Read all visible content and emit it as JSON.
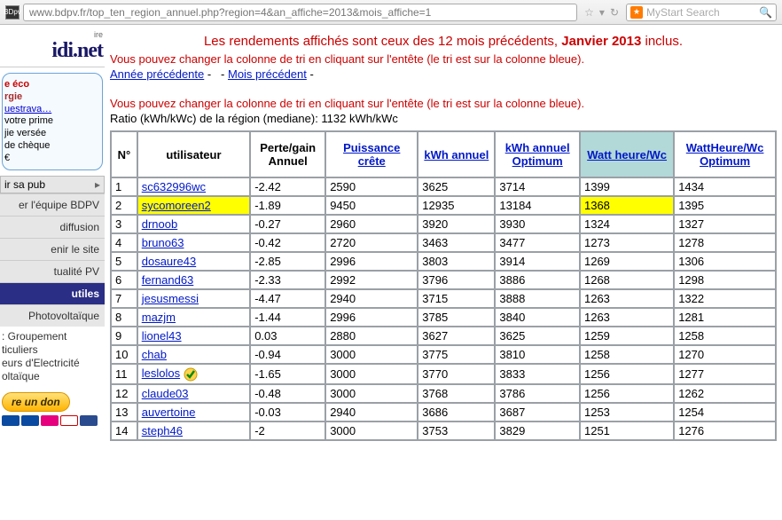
{
  "browser": {
    "url": "www.bdpv.fr/top_ten_region_annuel.php?region=4&an_affiche=2013&mois_affiche=1",
    "search_placeholder": "MyStart Search",
    "favicon_text": "BDpv"
  },
  "sidebar": {
    "logo": "idi.net",
    "panel_line1a": "e éco",
    "panel_line1b": "rgie",
    "panel_more": "uestrava…",
    "panel_line2": "votre prime",
    "panel_line3": "jie versée",
    "panel_line4": "de chèque",
    "panel_line5": "€",
    "pub": "ir sa pub",
    "items": [
      {
        "label": "er l'équipe BDPV"
      },
      {
        "label": "diffusion"
      },
      {
        "label": "enir le site"
      },
      {
        "label": "tualité PV"
      },
      {
        "label": "utiles"
      },
      {
        "label": "Photovoltaïque"
      }
    ],
    "sub": ": Groupement\nticuliers\neurs d'Electricité\noltaïque",
    "donate": "re un don"
  },
  "content": {
    "headline_pre": "Les rendements affichés sont ceux des 12 mois précédents, ",
    "headline_bold": "Janvier 2013",
    "headline_post": " inclus.",
    "info1": "Vous pouvez changer la colonne de tri en cliquant sur l'entête (le tri est sur la colonne bleue).",
    "link_prev_year": "Année précédente",
    "link_prev_month": "Mois précédent",
    "info2": "Vous pouvez changer la colonne de tri en cliquant sur l'entête (le tri est sur la colonne bleue).",
    "ratio": "Ratio (kWh/kWc) de la région (mediane): 1132 kWh/kWc",
    "headers": {
      "n": "N°",
      "user": "utilisateur",
      "perte": "Perte/gain Annuel",
      "pc": "Puissance crête",
      "kwh": "kWh annuel",
      "kwho": "kWh annuel Optimum",
      "wh": "Watt heure/Wc",
      "who": "WattHeure/Wc Optimum"
    },
    "rows": [
      {
        "n": "1",
        "user": "sc632996wc",
        "pg": "-2.42",
        "pc": "2590",
        "kwh": "3625",
        "kwho": "3714",
        "wh": "1399",
        "who": "1434"
      },
      {
        "n": "2",
        "user": "sycomoreen2",
        "pg": "-1.89",
        "pc": "9450",
        "kwh": "12935",
        "kwho": "13184",
        "wh": "1368",
        "who": "1395",
        "hl": true
      },
      {
        "n": "3",
        "user": "drnoob",
        "pg": "-0.27",
        "pc": "2960",
        "kwh": "3920",
        "kwho": "3930",
        "wh": "1324",
        "who": "1327"
      },
      {
        "n": "4",
        "user": "bruno63",
        "pg": "-0.42",
        "pc": "2720",
        "kwh": "3463",
        "kwho": "3477",
        "wh": "1273",
        "who": "1278"
      },
      {
        "n": "5",
        "user": "dosaure43",
        "pg": "-2.85",
        "pc": "2996",
        "kwh": "3803",
        "kwho": "3914",
        "wh": "1269",
        "who": "1306"
      },
      {
        "n": "6",
        "user": "fernand63",
        "pg": "-2.33",
        "pc": "2992",
        "kwh": "3796",
        "kwho": "3886",
        "wh": "1268",
        "who": "1298"
      },
      {
        "n": "7",
        "user": "jesusmessi",
        "pg": "-4.47",
        "pc": "2940",
        "kwh": "3715",
        "kwho": "3888",
        "wh": "1263",
        "who": "1322"
      },
      {
        "n": "8",
        "user": "mazjm",
        "pg": "-1.44",
        "pc": "2996",
        "kwh": "3785",
        "kwho": "3840",
        "wh": "1263",
        "who": "1281"
      },
      {
        "n": "9",
        "user": "lionel43",
        "pg": "0.03",
        "pc": "2880",
        "kwh": "3627",
        "kwho": "3625",
        "wh": "1259",
        "who": "1258"
      },
      {
        "n": "10",
        "user": "chab",
        "pg": "-0.94",
        "pc": "3000",
        "kwh": "3775",
        "kwho": "3810",
        "wh": "1258",
        "who": "1270"
      },
      {
        "n": "11",
        "user": "leslolos",
        "pg": "-1.65",
        "pc": "3000",
        "kwh": "3770",
        "kwho": "3833",
        "wh": "1256",
        "who": "1277",
        "badge": true
      },
      {
        "n": "12",
        "user": "claude03",
        "pg": "-0.48",
        "pc": "3000",
        "kwh": "3768",
        "kwho": "3786",
        "wh": "1256",
        "who": "1262"
      },
      {
        "n": "13",
        "user": "auvertoine",
        "pg": "-0.03",
        "pc": "2940",
        "kwh": "3686",
        "kwho": "3687",
        "wh": "1253",
        "who": "1254"
      },
      {
        "n": "14",
        "user": "steph46",
        "pg": "-2",
        "pc": "3000",
        "kwh": "3753",
        "kwho": "3829",
        "wh": "1251",
        "who": "1276"
      }
    ]
  }
}
